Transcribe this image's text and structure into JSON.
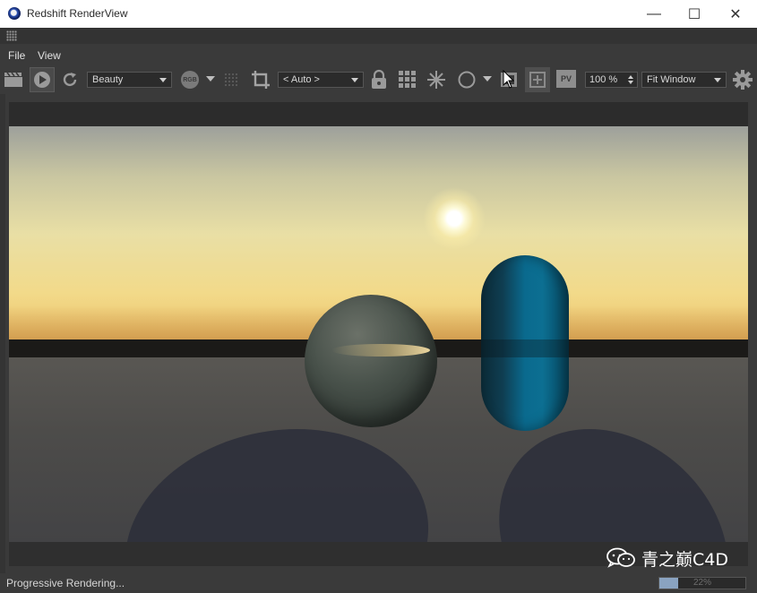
{
  "window": {
    "title": "Redshift RenderView",
    "minimize_symbol": "—",
    "maximize_symbol": "☐",
    "close_symbol": "✕"
  },
  "menu": {
    "items": [
      "File",
      "View"
    ]
  },
  "toolbar": {
    "aov_dropdown": "Beauty",
    "rgb_label": "RGB",
    "crop_dropdown": "< Auto >",
    "zoom_value": "100 %",
    "fit_dropdown": "Fit Window",
    "pv_label": "PV"
  },
  "icons": {
    "clapper": "clapperboard-icon",
    "play": "play-icon",
    "refresh": "refresh-icon",
    "rgb": "rgb-channel-icon",
    "grid_dots": "dotted-grid-icon",
    "crop": "crop-icon",
    "lock": "lock-icon",
    "grid": "grid-icon",
    "snowflake": "snowflake-icon",
    "circle": "circle-icon",
    "snapshot": "snapshot-icon",
    "add": "add-snapshot-icon",
    "pv": "pv-icon",
    "settings": "gear-icon",
    "cursor": "mouse-cursor"
  },
  "watermark": {
    "text": "青之巅C4D"
  },
  "status": {
    "text": "Progressive Rendering...",
    "progress": 0.22,
    "progress_label": "22%"
  },
  "colors": {
    "panel": "#3a3a3a",
    "viewport_frame": "#2c2c2c",
    "progress_fill": "#8aa3c0"
  }
}
